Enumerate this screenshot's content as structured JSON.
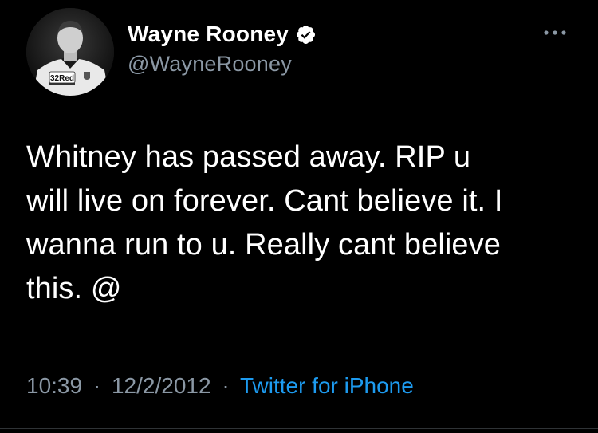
{
  "tweet": {
    "author": {
      "display_name": "Wayne Rooney",
      "handle": "@WayneRooney",
      "verified": true,
      "avatar_shirt_text": "32Red"
    },
    "text": "Whitney has passed away. RIP u\nwill live on forever. Cant believe it. I\nwanna run to u. Really cant believe\nthis. @",
    "meta": {
      "time": "10:39",
      "separator": "·",
      "date": "12/2/2012",
      "source": "Twitter for iPhone"
    },
    "more_icon": "more-horizontal-icon",
    "verified_icon": "verified-badge-icon"
  },
  "colors": {
    "background": "#000000",
    "text_primary": "#ffffff",
    "text_secondary": "#8b98a5",
    "link": "#1d9bf0",
    "divider": "#2f3336"
  }
}
